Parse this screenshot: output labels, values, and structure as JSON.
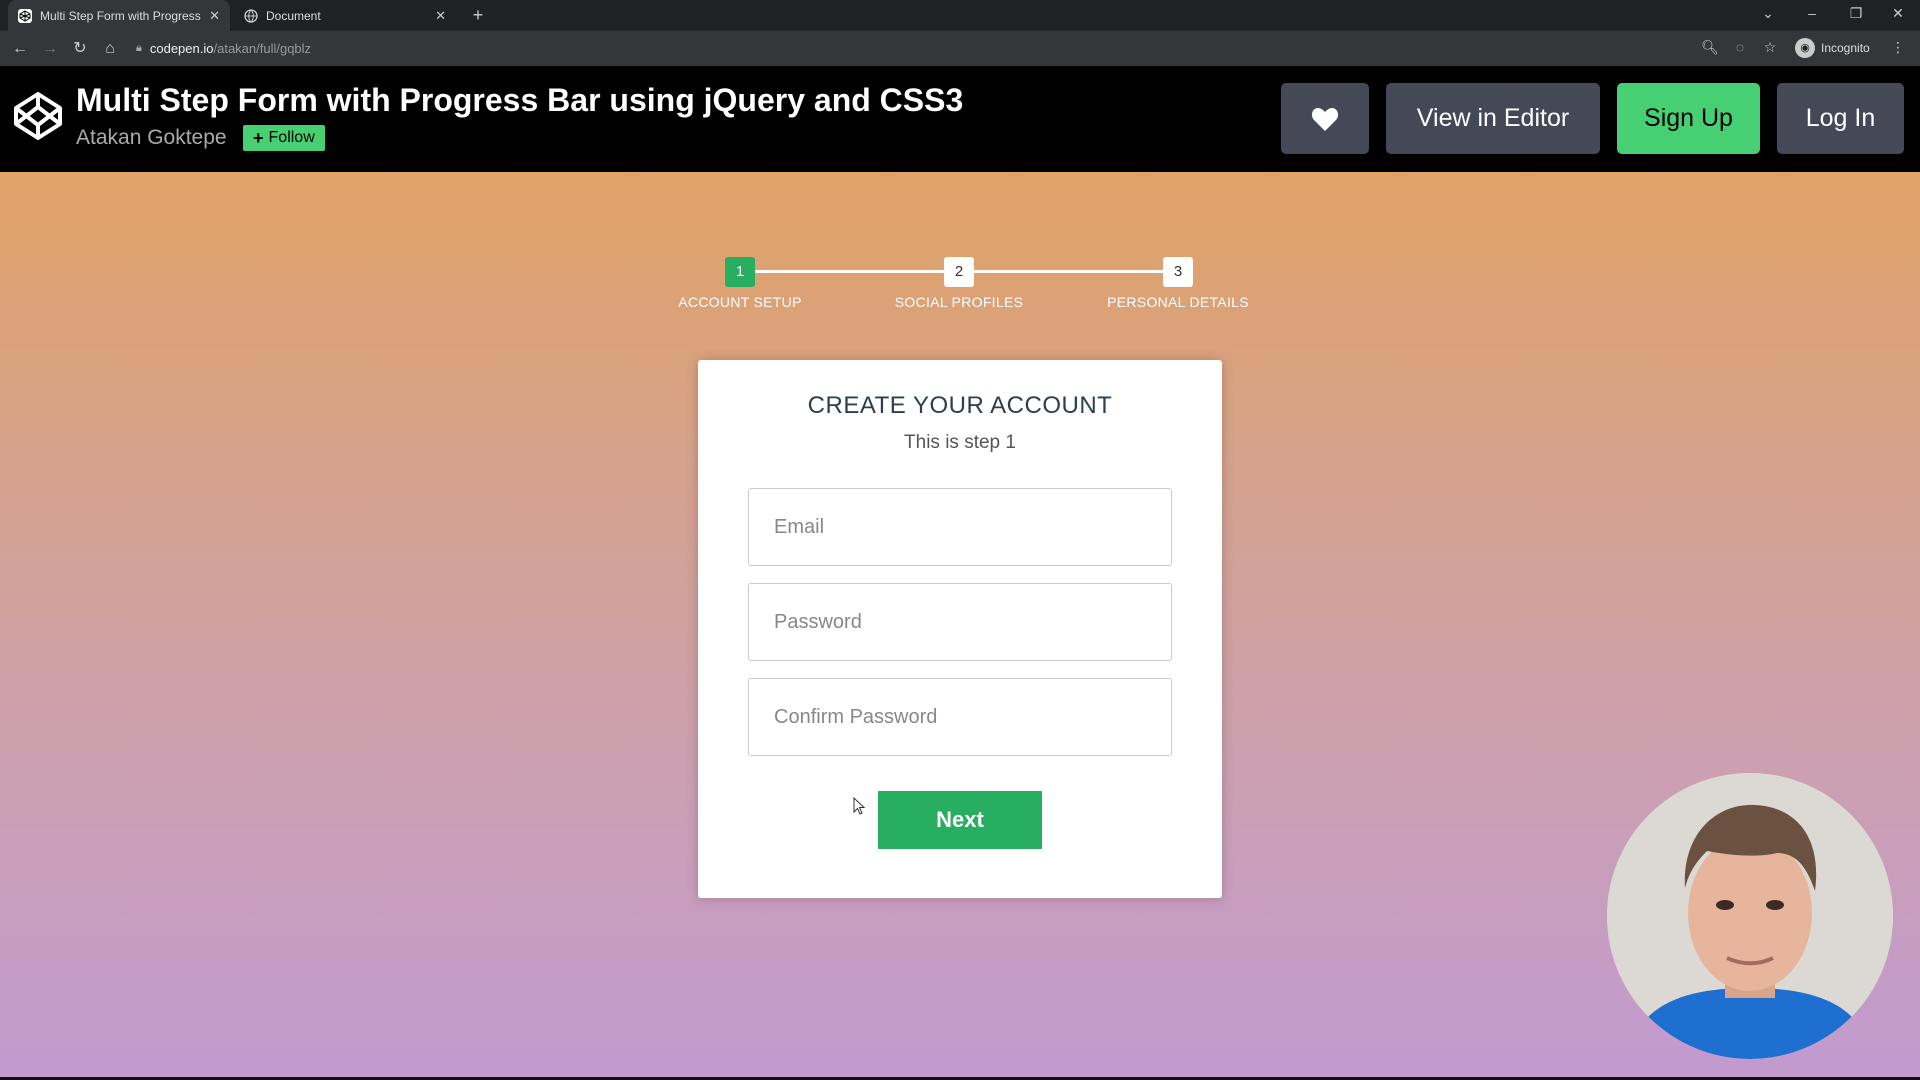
{
  "browser": {
    "tabs": [
      {
        "title": "Multi Step Form with Progress B",
        "active": true
      },
      {
        "title": "Document",
        "active": false
      }
    ],
    "url_host": "codepen.io",
    "url_path": "/atakan/full/gqblz",
    "profile_label": "Incognito"
  },
  "header": {
    "title": "Multi Step Form with Progress Bar using jQuery and CSS3",
    "author": "Atakan Goktepe",
    "follow_label": "Follow",
    "view_editor_label": "View in Editor",
    "signup_label": "Sign Up",
    "login_label": "Log In"
  },
  "progress": {
    "steps": [
      {
        "number": "1",
        "label": "ACCOUNT SETUP",
        "active": true
      },
      {
        "number": "2",
        "label": "SOCIAL PROFILES",
        "active": false
      },
      {
        "number": "3",
        "label": "PERSONAL DETAILS",
        "active": false
      }
    ]
  },
  "form": {
    "title": "CREATE YOUR ACCOUNT",
    "subtitle": "This is step 1",
    "email_placeholder": "Email",
    "password_placeholder": "Password",
    "confirm_placeholder": "Confirm Password",
    "next_label": "Next"
  },
  "colors": {
    "accent_green": "#27ae60",
    "codepen_green": "#47cf73",
    "header_button_gray": "#444857"
  }
}
